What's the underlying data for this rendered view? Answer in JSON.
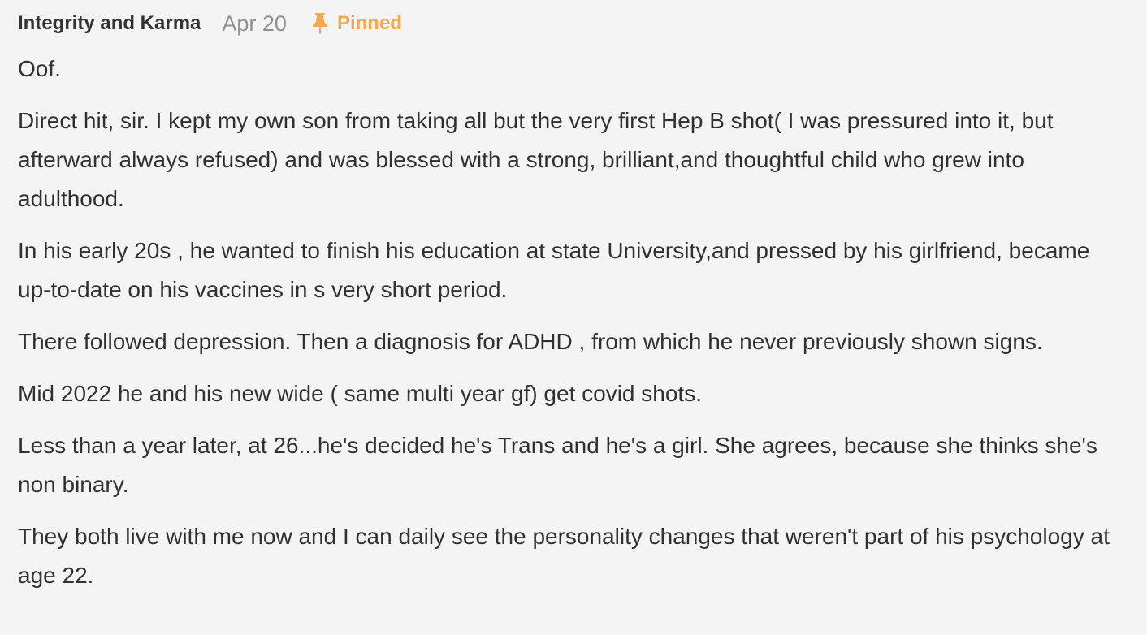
{
  "comment": {
    "author": "Integrity and Karma",
    "date": "Apr 20",
    "pinned_label": "Pinned",
    "pin_icon": "pin-icon",
    "accent_color": "#f5a84c",
    "paragraphs": [
      "Oof.",
      "Direct hit, sir. I kept my own son from taking all but the very first Hep B shot( I was pressured into it, but afterward always refused) and was blessed with a strong, brilliant,and thoughtful child who grew into adulthood.",
      "In his early 20s , he wanted to finish his education at state University,and pressed by his girlfriend, became up-to-date on his vaccines in s very short period.",
      "There followed depression. Then a diagnosis for ADHD , from which he never previously shown signs.",
      "Mid 2022 he and his new wide ( same multi year gf) get covid shots.",
      "Less than a year later, at 26...he's decided he's Trans and he's a girl. She agrees, because she thinks she's non binary.",
      "They both live with me now and I can daily see the personality changes that weren't part of his psychology at age 22."
    ]
  }
}
